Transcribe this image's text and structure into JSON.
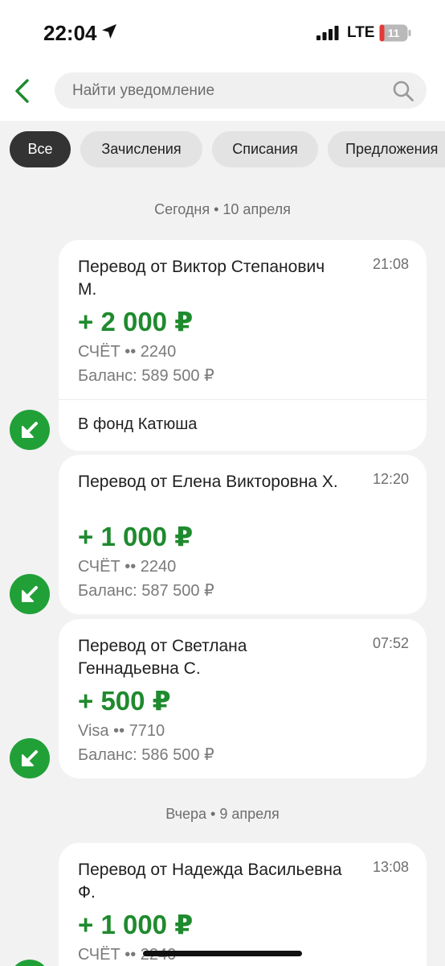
{
  "status_bar": {
    "time": "22:04",
    "network": "LTE",
    "battery": "11"
  },
  "header": {
    "search_placeholder": "Найти уведомление"
  },
  "filters": [
    {
      "label": "Все",
      "active": true
    },
    {
      "label": "Зачисления",
      "active": false
    },
    {
      "label": "Списания",
      "active": false
    },
    {
      "label": "Предложения",
      "active": false
    }
  ],
  "groups": [
    {
      "date_label": "Сегодня • 10 апреля",
      "items": [
        {
          "title": "Перевод от Виктор Степанович М.",
          "time": "21:08",
          "amount": "+ 2 000 ₽",
          "account": "СЧЁТ •• 2240",
          "balance": "Баланс: 589 500 ₽",
          "comment": "В фонд Катюша"
        },
        {
          "title": "Перевод от Елена Викторовна Х.",
          "time": "12:20",
          "amount": "+ 1 000 ₽",
          "account": "СЧЁТ •• 2240",
          "balance": "Баланс: 587 500 ₽"
        },
        {
          "title": "Перевод от Светлана Геннадьевна С.",
          "time": "07:52",
          "amount": "+ 500 ₽",
          "account": "Visa •• 7710",
          "balance": "Баланс: 586 500 ₽"
        }
      ]
    },
    {
      "date_label": "Вчера • 9 апреля",
      "items": [
        {
          "title": "Перевод от Надежда Васильевна Ф.",
          "time": "13:08",
          "amount": "+ 1 000 ₽",
          "account": "СЧЁТ •• 2240"
        }
      ]
    }
  ],
  "icons": {
    "back": "chevron-left-icon",
    "search": "search-icon",
    "incoming": "arrow-down-left-icon"
  },
  "colors": {
    "accent_green": "#1f8a2e",
    "badge_green": "#21a038",
    "active_chip": "#333333"
  }
}
